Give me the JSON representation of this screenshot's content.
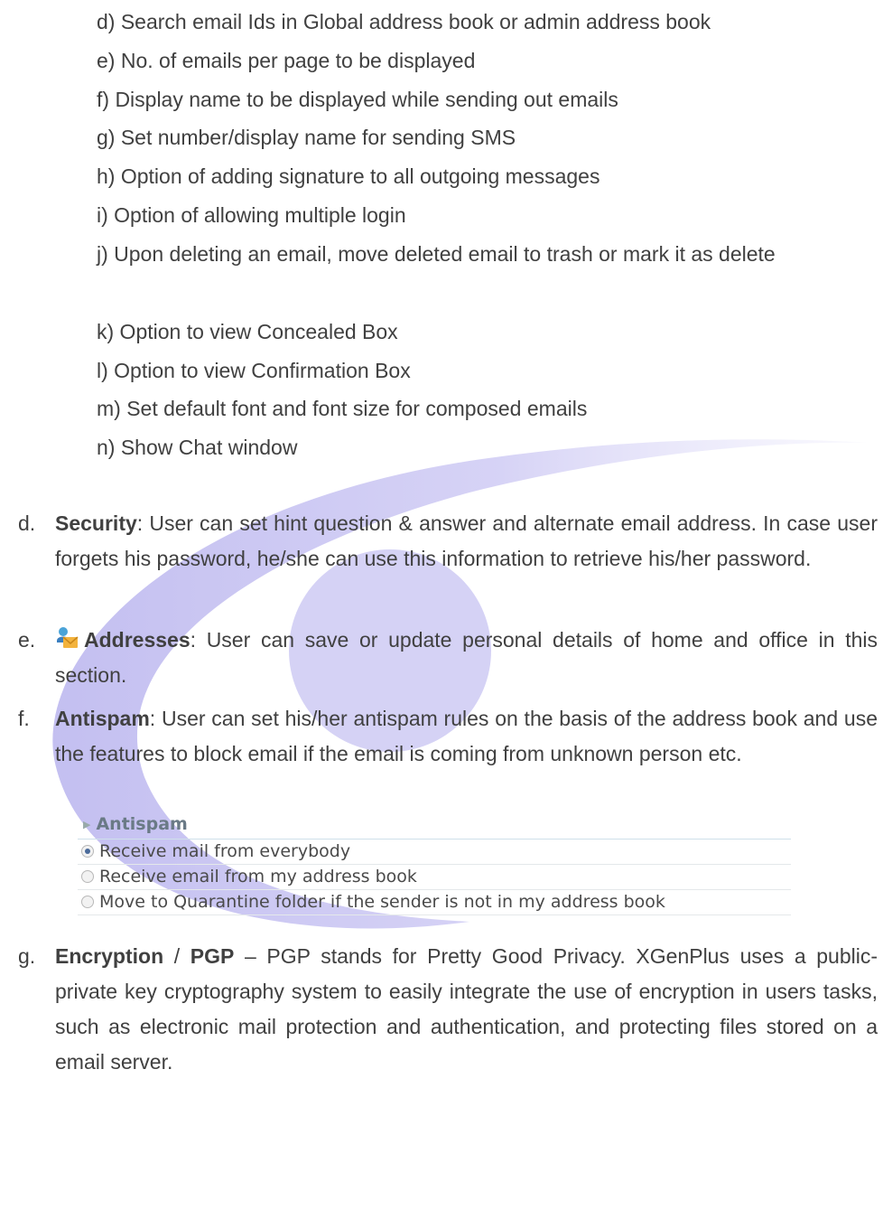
{
  "sub_items": [
    "d) Search email Ids in Global address book or admin address book",
    "e) No. of emails per page to be displayed",
    "f) Display name to be displayed while sending out emails",
    "g) Set number/display name for sending SMS",
    "h) Option of adding signature to all outgoing messages",
    "i) Option of allowing multiple login",
    "j) Upon deleting an email, move deleted email to trash or mark it as delete",
    "k) Option to view Concealed Box",
    "l) Option to view Confirmation Box",
    "m) Set default font and font size for composed emails",
    "n) Show Chat window"
  ],
  "items": {
    "security": {
      "letter": "d.",
      "term": "Security",
      "text": ": User can set hint question & answer and alternate email address. In case user forgets his password, he/she can use this information to retrieve his/her password."
    },
    "addresses": {
      "letter": "e.",
      "icon": "address-book-mail-icon",
      "term": "Addresses",
      "text": ": User can save or update personal details of home and office in this section."
    },
    "antispam": {
      "letter": "f.",
      "term": "Antispam",
      "text": ": User can set his/her antispam rules on the basis of the address book and use the features to block email if the email is coming from unknown person etc."
    },
    "encryption": {
      "letter": "g.",
      "term": "Encryption",
      "sep": " / ",
      "term2": "PGP",
      "text": " – PGP stands for Pretty Good Privacy. XGenPlus uses a public-private key cryptography system to easily integrate the use of encryption in users tasks, such as electronic mail protection and authentication, and protecting files stored on a email server."
    }
  },
  "antispam_panel": {
    "title": "Antispam",
    "options": [
      {
        "label": "Receive mail from everybody",
        "selected": true
      },
      {
        "label": "Receive email from my address book",
        "selected": false
      },
      {
        "label": "Move to Quarantine folder if the sender is not in my address book",
        "selected": false
      }
    ]
  },
  "colors": {
    "text": "#404040",
    "watermark": "#c9c6f0",
    "panel_border": "#cfe0ea"
  }
}
